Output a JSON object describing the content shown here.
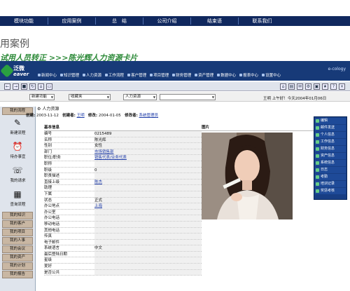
{
  "top_nav": [
    "模块功能",
    "应用案例",
    "总　结",
    "公司介绍",
    "结束语",
    "联系我们"
  ],
  "heading": "用案例",
  "banner": "试用人员转正 >>>陈光辉人力资源卡片",
  "logo": {
    "text1": "泛微",
    "text2": "eaver"
  },
  "brand": "e-cology",
  "modules": [
    "新闻中心",
    "知识管理",
    "人力资源",
    "工作流程",
    "客户管理",
    "项目管理",
    "财务管理",
    "资产管理",
    "数据中心",
    "报表中心",
    "设置中心"
  ],
  "filters": {
    "f1": "新建功能",
    "f2": "收藏夹",
    "f3": "人力资源"
  },
  "user": {
    "name": "王明",
    "greeting": "上午好！今天2004年01月06日"
  },
  "sidebar": {
    "top_tab": "我的流程",
    "icons": [
      {
        "label": "新建流程",
        "icon": "pencil-icon"
      },
      {
        "label": "待办事宜",
        "icon": "alarm-clock-icon"
      },
      {
        "label": "我的请求",
        "icon": "speech-icon"
      },
      {
        "label": "查询流程",
        "icon": "search-doc-icon"
      }
    ],
    "tabs": [
      "我的知识",
      "我的客户",
      "我的项目",
      "我的人事",
      "我的会议",
      "我的资产",
      "我的计划",
      "我的报告"
    ]
  },
  "page": {
    "title": "人力资源",
    "meta_created_label": "创建:",
    "meta_created": "2003-11-12",
    "meta_creator_label": "创建者:",
    "meta_creator": "王明",
    "meta_modified_label": "修改:",
    "meta_modified": "2004-01-05",
    "meta_modifier_label": "修改者:",
    "meta_modifier": "系统管理员"
  },
  "basic": {
    "title": "基本信息",
    "rows": [
      [
        "编号",
        "0215489"
      ],
      [
        "名称",
        "陈光辉"
      ],
      [
        "性别",
        "女性"
      ],
      [
        "部门",
        "市场销售部"
      ],
      [
        "职位/职务",
        "销售代表/业务代表"
      ],
      [
        "职称",
        ""
      ],
      [
        "职级",
        "0"
      ],
      [
        "职责描述",
        ""
      ],
      [
        "直接上级",
        "陈杰"
      ],
      [
        "助理",
        ""
      ],
      [
        "下属",
        ""
      ],
      [
        "状态",
        "正式"
      ],
      [
        "办公地点",
        "上海"
      ],
      [
        "办公室",
        ""
      ],
      [
        "办公电话",
        ""
      ],
      [
        "移动电话",
        ""
      ],
      [
        "其他电话",
        ""
      ],
      [
        "传真",
        ""
      ],
      [
        "电子邮件",
        ""
      ],
      [
        "系统语言",
        "中文"
      ],
      [
        "最后登陆日期",
        ""
      ],
      [
        "星级",
        ""
      ],
      [
        "爱好",
        ""
      ],
      [
        "是否公共",
        ""
      ]
    ]
  },
  "photo_title": "图片",
  "popup": [
    "编辑",
    "邮件发送",
    "个人信息",
    "工作信息",
    "财务信息",
    "资产信息",
    "系统信息",
    "日志",
    "考勤",
    "培训记录",
    "奖惩考核"
  ]
}
